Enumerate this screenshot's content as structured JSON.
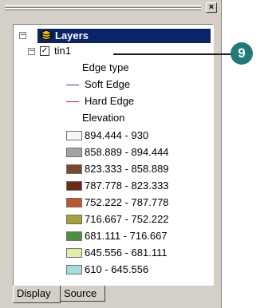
{
  "toc": {
    "root_label": "Layers",
    "root_expander": "−",
    "layer": {
      "name": "tin1",
      "expander": "−",
      "checked_glyph": "✓"
    },
    "edge_type_heading": "Edge type",
    "edges": [
      {
        "label": "Soft Edge",
        "color": "#3a3aa8"
      },
      {
        "label": "Hard Edge",
        "color": "#d02020"
      }
    ],
    "elevation_heading": "Elevation",
    "elevation_classes": [
      {
        "range": "894.444 - 930",
        "color": "#f7f7f7"
      },
      {
        "range": "858.889 - 894.444",
        "color": "#a3a3a3"
      },
      {
        "range": "823.333 - 858.889",
        "color": "#7a4a30"
      },
      {
        "range": "787.778 - 823.333",
        "color": "#6a2c18"
      },
      {
        "range": "752.222 - 787.778",
        "color": "#c2542a"
      },
      {
        "range": "716.667 - 752.222",
        "color": "#a8a038"
      },
      {
        "range": "681.111 - 716.667",
        "color": "#48903e"
      },
      {
        "range": "645.556 - 681.111",
        "color": "#e4eca8"
      },
      {
        "range": "610 - 645.556",
        "color": "#a8dcdc"
      }
    ]
  },
  "tabs": [
    "Display",
    "Source"
  ],
  "window": {
    "close_glyph": "×"
  },
  "callout": {
    "number": "9",
    "color": "#1f7a7a"
  }
}
